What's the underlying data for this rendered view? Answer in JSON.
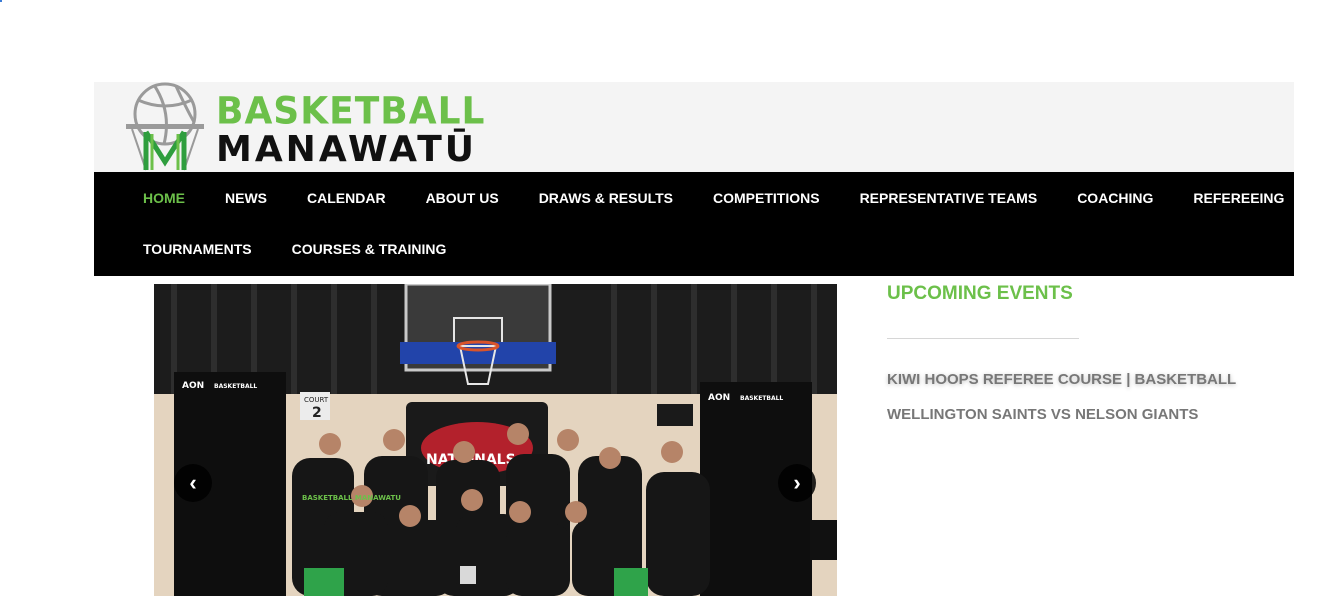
{
  "brand": {
    "line1": "BASKETBALL",
    "line2": "MANAWATŪ",
    "green": "#6cc04a",
    "dark": "#111111"
  },
  "nav": {
    "row1": [
      {
        "label": "HOME",
        "active": true
      },
      {
        "label": "NEWS"
      },
      {
        "label": "CALENDAR"
      },
      {
        "label": "ABOUT US"
      },
      {
        "label": "DRAWS & RESULTS"
      },
      {
        "label": "COMPETITIONS"
      },
      {
        "label": "REPRESENTATIVE TEAMS"
      },
      {
        "label": "COACHING"
      },
      {
        "label": "REFEREEING"
      }
    ],
    "row2": [
      {
        "label": "TOURNAMENTS"
      },
      {
        "label": "COURSES & TRAINING"
      }
    ]
  },
  "slider": {
    "prev_icon": "chevron-left-icon",
    "next_icon": "chevron-right-icon",
    "prev_glyph": "‹",
    "next_glyph": "›",
    "photo": {
      "court_label": "COURT",
      "court_number": "2",
      "banner_text": "NATIONALS",
      "sponsor": "AON",
      "partner": "BASKETBALL",
      "shirt_text": "BASKETBALL MANAWATU"
    }
  },
  "sidebar": {
    "title": "UPCOMING EVENTS",
    "events": [
      "KIWI HOOPS REFEREE COURSE | BASKETBALL",
      "WELLINGTON SAINTS VS NELSON GIANTS"
    ]
  }
}
